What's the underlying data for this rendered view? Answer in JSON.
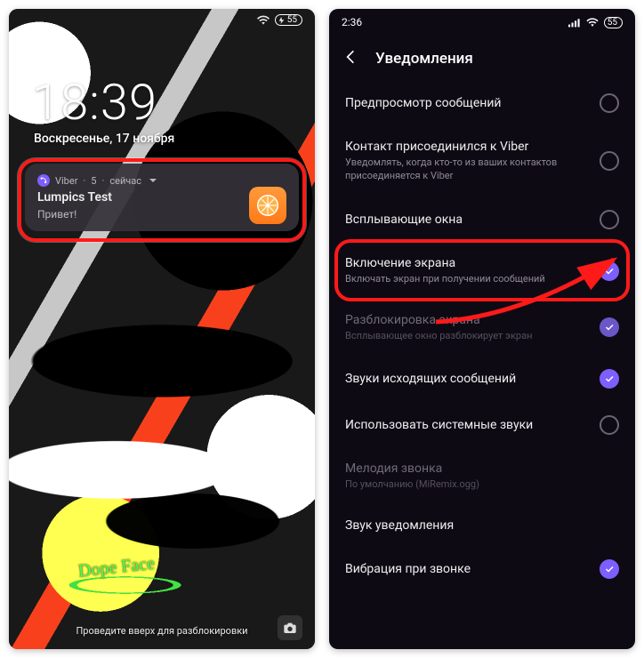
{
  "left": {
    "battery": "55",
    "time": "18:39",
    "date": "Воскресенье, 17 ноября",
    "notif": {
      "app": "Viber",
      "count": "5",
      "when": "сейчас",
      "title": "Lumpics Test",
      "body": "Привет!",
      "icon_name": "orange-slice-icon",
      "app_icon_name": "viber-icon"
    },
    "graffiti_text": "Dope Face",
    "swipe_hint": "Проведите вверх для разблокировки",
    "camera_icon": "camera-icon"
  },
  "right": {
    "time": "2:36",
    "battery": "55",
    "header": {
      "back_icon": "back-icon",
      "title": "Уведомления"
    },
    "rows": [
      {
        "title": "Предпросмотр сообщений",
        "sub": "",
        "state": "radio-off",
        "enabled": true
      },
      {
        "title": "Контакт присоединился к Viber",
        "sub": "Уведомлять, когда кто-то из ваших контактов присоединяется к Viber",
        "state": "radio-off",
        "enabled": true
      },
      {
        "title": "Всплывающие окна",
        "sub": "",
        "state": "radio-off",
        "enabled": true
      },
      {
        "title": "Включение экрана",
        "sub": "Включать экран при получении сообщений",
        "state": "checked",
        "enabled": true,
        "highlight": true
      },
      {
        "title": "Разблокировка экрана",
        "sub": "Всплывающее окно разблокирует экран",
        "state": "checked-dim",
        "enabled": false
      },
      {
        "title": "Звуки исходящих сообщений",
        "sub": "",
        "state": "checked",
        "enabled": true
      },
      {
        "title": "Использовать системные звуки",
        "sub": "",
        "state": "radio-off",
        "enabled": true
      },
      {
        "title": "Мелодия звонка",
        "sub": "По умолчанию (MiRemix.ogg)",
        "state": "none",
        "enabled": false
      },
      {
        "title": "Звук уведомления",
        "sub": "",
        "state": "none",
        "enabled": true
      },
      {
        "title": "Вибрация при звонке",
        "sub": "",
        "state": "checked",
        "enabled": true
      }
    ]
  },
  "colors": {
    "accent": "#7d5fff",
    "highlight": "#ff1a1a"
  }
}
